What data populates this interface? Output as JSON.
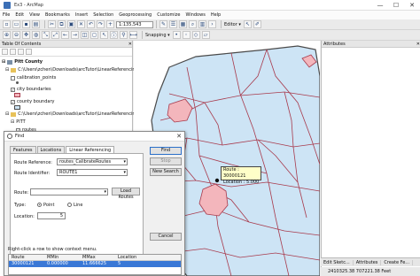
{
  "window": {
    "title": "Ex3 - ArcMap",
    "controls": [
      "—",
      "☐",
      "✕"
    ]
  },
  "menu": [
    "File",
    "Edit",
    "View",
    "Bookmarks",
    "Insert",
    "Selection",
    "Geoprocessing",
    "Customize",
    "Windows",
    "Help"
  ],
  "toolbar": {
    "scale": "1:135,543",
    "editor_label": "Editor ▾",
    "snapping_label": "Snapping ▾"
  },
  "toc": {
    "title": "Table Of Contents",
    "layers": [
      {
        "label": "Pitt County",
        "bold": true
      },
      {
        "label": "C:\\Users\\zchen\\Downloads\\arcTutor\\LinearReferencin"
      },
      {
        "label": "calibration_points"
      },
      {
        "label": "city boundaries"
      },
      {
        "label": "county boundary"
      },
      {
        "label": "C:\\Users\\zchen\\Downloads\\arcTutor\\LinearReferencin"
      },
      {
        "label": "PITT"
      },
      {
        "label": "routes"
      }
    ]
  },
  "find": {
    "title": "Find",
    "tabs": [
      "Features",
      "Locations",
      "Linear Referencing"
    ],
    "route_reference_label": "Route Reference:",
    "route_reference_value": "routes_CalibrateRoutes",
    "route_identifier_label": "Route Identifier:",
    "route_identifier_value": "ROUTE1",
    "route_label": "Route:",
    "load_routes": "Load Routes",
    "type_label": "Type:",
    "point_label": "Point",
    "line_label": "Line",
    "location_label": "Location:",
    "location_value": "5",
    "buttons": {
      "find": "Find",
      "stop": "Stop",
      "new_search": "New Search",
      "cancel": "Cancel"
    },
    "results_hint": "Right-click a row to show context menu.",
    "results_columns": [
      "Route",
      "MMin",
      "MMax",
      "Location"
    ],
    "results_rows": [
      [
        "30000121",
        "0.000000",
        "11.666625",
        "5"
      ]
    ]
  },
  "callout": {
    "line1": "Route : 30000121",
    "line2": "Location : 5.000"
  },
  "attributes": {
    "title": "Attributes",
    "tabs": [
      "Edit Sketc...",
      "Attributes",
      "Create Fe..."
    ]
  },
  "status": {
    "coords": "2410325.38  707221.38 Feet"
  },
  "colors": {
    "county_fill": "#cde4f5",
    "city_fill": "#f3b6bc",
    "road_stroke": "#a83a4c",
    "county_outline": "#4a4a4a",
    "selection_row": "#3a78d6"
  }
}
